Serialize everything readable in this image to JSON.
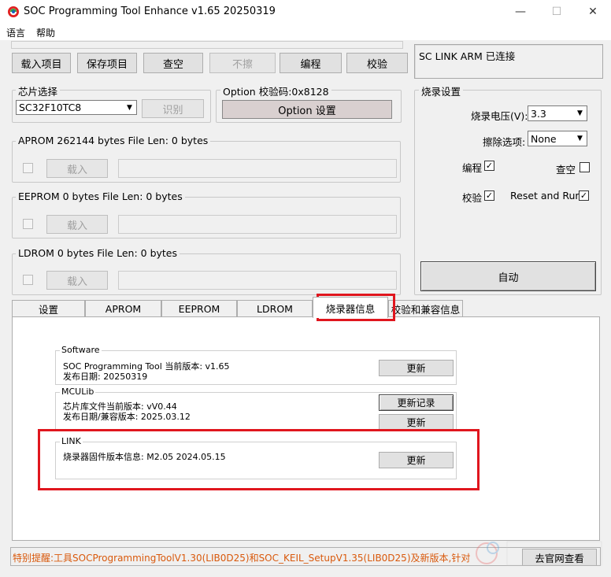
{
  "window": {
    "title": "SOC Programming Tool Enhance v1.65 20250319",
    "minimize": "—",
    "maximize": "☐",
    "close": "✕"
  },
  "menu": [
    "语言",
    "帮助"
  ],
  "toolbar": {
    "load_project": "载入项目",
    "save_project": "保存项目",
    "clear": "查空",
    "erase": "不擦",
    "program": "编程",
    "verify": "校验"
  },
  "connection_status": "SC LINK ARM 已连接",
  "chip_select": {
    "label": "芯片选择",
    "value": "SC32F10TC8",
    "identify": "识别"
  },
  "option": {
    "label": "Option  校验码:0x8128",
    "button": "Option 设置"
  },
  "aprom": {
    "label": "APROM 262144 bytes    File Len: 0 bytes",
    "load": "载入"
  },
  "eeprom": {
    "label": "EEPROM 0 bytes    File Len: 0 bytes",
    "load": "载入"
  },
  "ldrom": {
    "label": "LDROM 0 bytes    File Len: 0 bytes",
    "load": "载入"
  },
  "burn_settings": {
    "label": "烧录设置",
    "voltage_label": "烧录电压(V):",
    "voltage_value": "3.3",
    "erase_label": "擦除选项:",
    "erase_value": "None",
    "program_label": "编程",
    "program_checked": true,
    "blank_label": "查空",
    "blank_checked": false,
    "verify_label": "校验",
    "verify_checked": true,
    "reset_run_label": "Reset and Run",
    "reset_run_checked": true,
    "auto_button": "自动"
  },
  "tabs": [
    "设置",
    "APROM",
    "EEPROM",
    "LDROM",
    "烧录器信息",
    "校验和兼容信息"
  ],
  "active_tab": 4,
  "info": {
    "software": {
      "label": "Software",
      "line1": "SOC  Programming Tool 当前版本: v1.65",
      "line2": "发布日期: 20250319",
      "update": "更新"
    },
    "mculib": {
      "label": "MCULib",
      "line1": "芯片库文件当前版本: vV0.44",
      "line2": "发布日期/兼容版本: 2025.03.12",
      "update_log": "更新记录",
      "update": "更新"
    },
    "link": {
      "label": "LINK",
      "line1": "烧录器固件版本信息: M2.05 2024.05.15",
      "update": "更新"
    }
  },
  "status_bar": {
    "text": "特别提醒:工具SOCProgrammingToolV1.30(LIB0D25)和SOC_KEIL_SetupV1.35(LIB0D25)及新版本,针对",
    "visit_button": "去官网查看"
  },
  "colors": {
    "highlight_red": "#e0161e",
    "status_text": "#d9590c",
    "window_bg": "#f0f0f0"
  }
}
